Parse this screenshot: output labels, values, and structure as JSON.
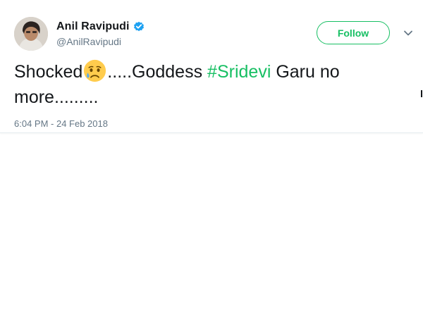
{
  "author": {
    "name": "Anil Ravipudi",
    "handle": "@AnilRavipudi",
    "verified": true
  },
  "actions": {
    "follow_label": "Follow"
  },
  "tweet": {
    "text_part1": "Shocked",
    "emoji": "disappointed-but-relieved-face",
    "text_part2": ".....Goddess ",
    "hashtag": "#Sridevi",
    "text_part3": " Garu no more.........",
    "timestamp": "6:04 PM - 24 Feb 2018"
  },
  "colors": {
    "accent": "#17bf63",
    "verified": "#1da1f2",
    "secondary_text": "#657786"
  }
}
